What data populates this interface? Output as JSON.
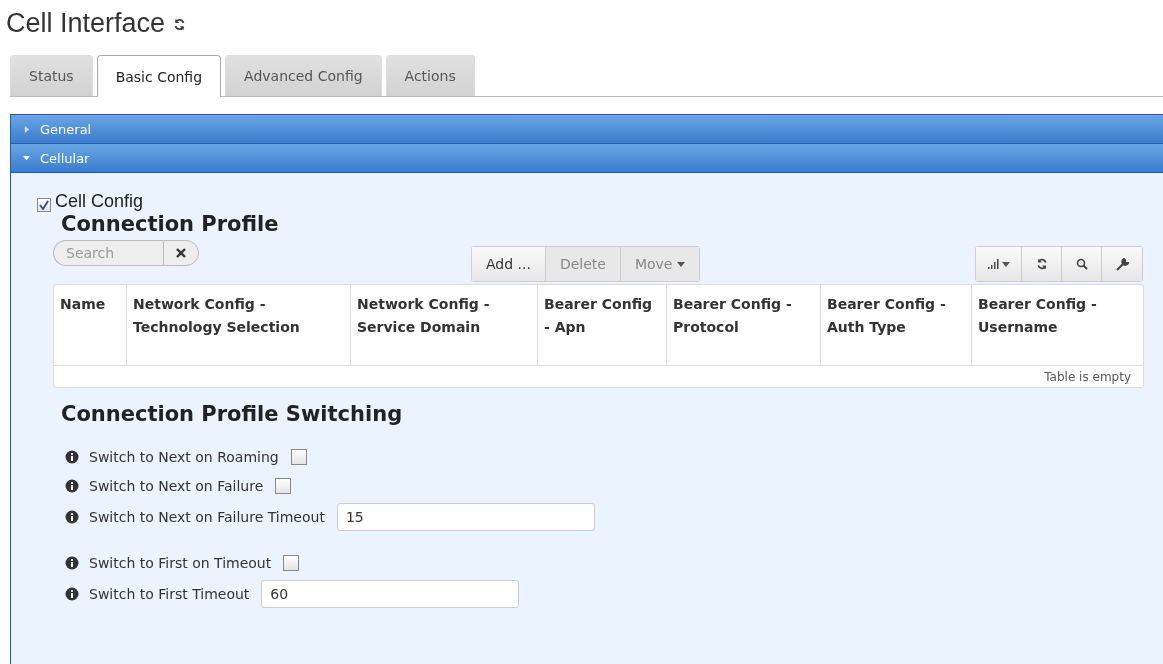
{
  "page": {
    "title": "Cell Interface"
  },
  "tabs": [
    {
      "label": "Status",
      "selected": false
    },
    {
      "label": "Basic Config",
      "selected": true
    },
    {
      "label": "Advanced Config",
      "selected": false
    },
    {
      "label": "Actions",
      "selected": false
    }
  ],
  "sections": [
    {
      "label": "General",
      "expanded": false
    },
    {
      "label": "Cellular",
      "expanded": true
    }
  ],
  "cell_config": {
    "label": "Cell Config",
    "checked": true
  },
  "connection_profile": {
    "heading": "Connection Profile",
    "search": {
      "placeholder": "Search"
    },
    "buttons": [
      {
        "label": "Add ...",
        "disabled": false
      },
      {
        "label": "Delete",
        "disabled": true
      },
      {
        "label": "Move",
        "disabled": true,
        "dropdown": true
      }
    ],
    "table": {
      "columns": [
        "Name",
        "Network Config - Technology Selection",
        "Network Config - Service Domain",
        "Bearer Config - Apn",
        "Bearer Config - Protocol",
        "Bearer Config - Auth Type",
        "Bearer Config - Username"
      ],
      "footer": "Table is empty"
    }
  },
  "switching": {
    "heading": "Connection Profile Switching",
    "fields": [
      {
        "label": "Switch to Next on Roaming",
        "kind": "checkbox",
        "checked": false
      },
      {
        "label": "Switch to Next on Failure",
        "kind": "checkbox",
        "checked": false
      },
      {
        "label": "Switch to Next on Failure Timeout",
        "kind": "text",
        "value": "15"
      },
      {
        "label": "Switch to First on Timeout",
        "kind": "checkbox",
        "checked": false
      },
      {
        "label": "Switch to First Timeout",
        "kind": "text",
        "value": "60"
      }
    ]
  }
}
